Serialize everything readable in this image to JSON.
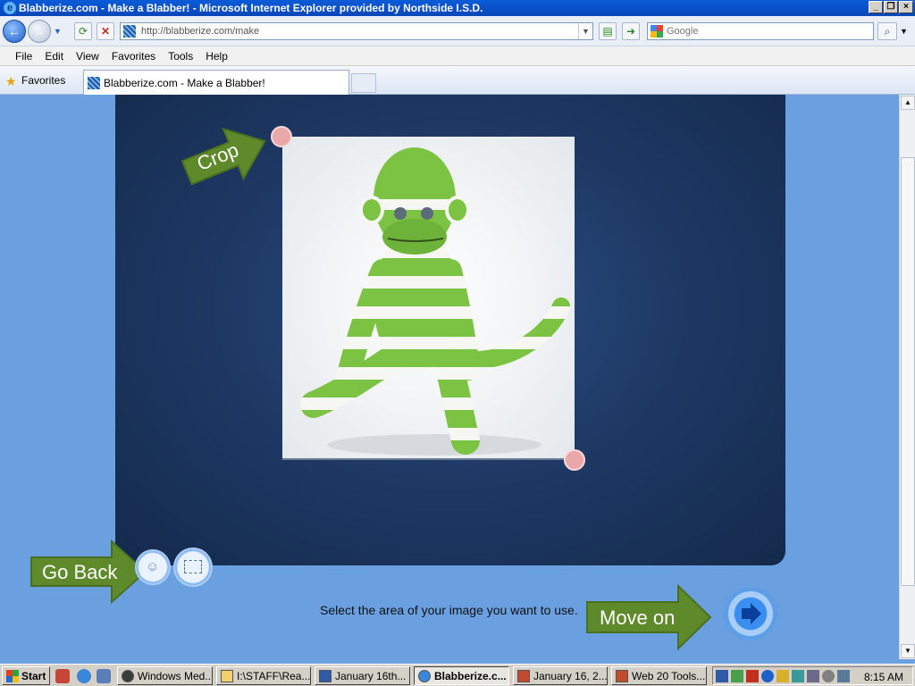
{
  "window": {
    "title": "Blabberize.com - Make a Blabber! - Microsoft Internet Explorer provided by Northside I.S.D."
  },
  "toolbar": {
    "address": "http://blabberize.com/make",
    "search_placeholder": "Google"
  },
  "menu": [
    "File",
    "Edit",
    "View",
    "Favorites",
    "Tools",
    "Help"
  ],
  "favorites": {
    "label": "Favorites",
    "tab_title": "Blabberize.com - Make a Blabber!"
  },
  "page": {
    "crop_label": "Crop",
    "go_back_label": "Go Back",
    "move_on_label": "Move on",
    "instruction": "Select the area of your image you want to use.",
    "accent_color": "#5f8a2c",
    "stage_color": "#1f3a66"
  },
  "taskbar": {
    "start_label": "Start",
    "tasks": [
      {
        "label": "Windows Med..."
      },
      {
        "label": "I:\\STAFF\\Rea..."
      },
      {
        "label": "January 16th..."
      },
      {
        "label": "Blabberize.c..."
      },
      {
        "label": "January 16, 2..."
      },
      {
        "label": "Web 20 Tools..."
      }
    ],
    "clock": "8:15 AM"
  }
}
